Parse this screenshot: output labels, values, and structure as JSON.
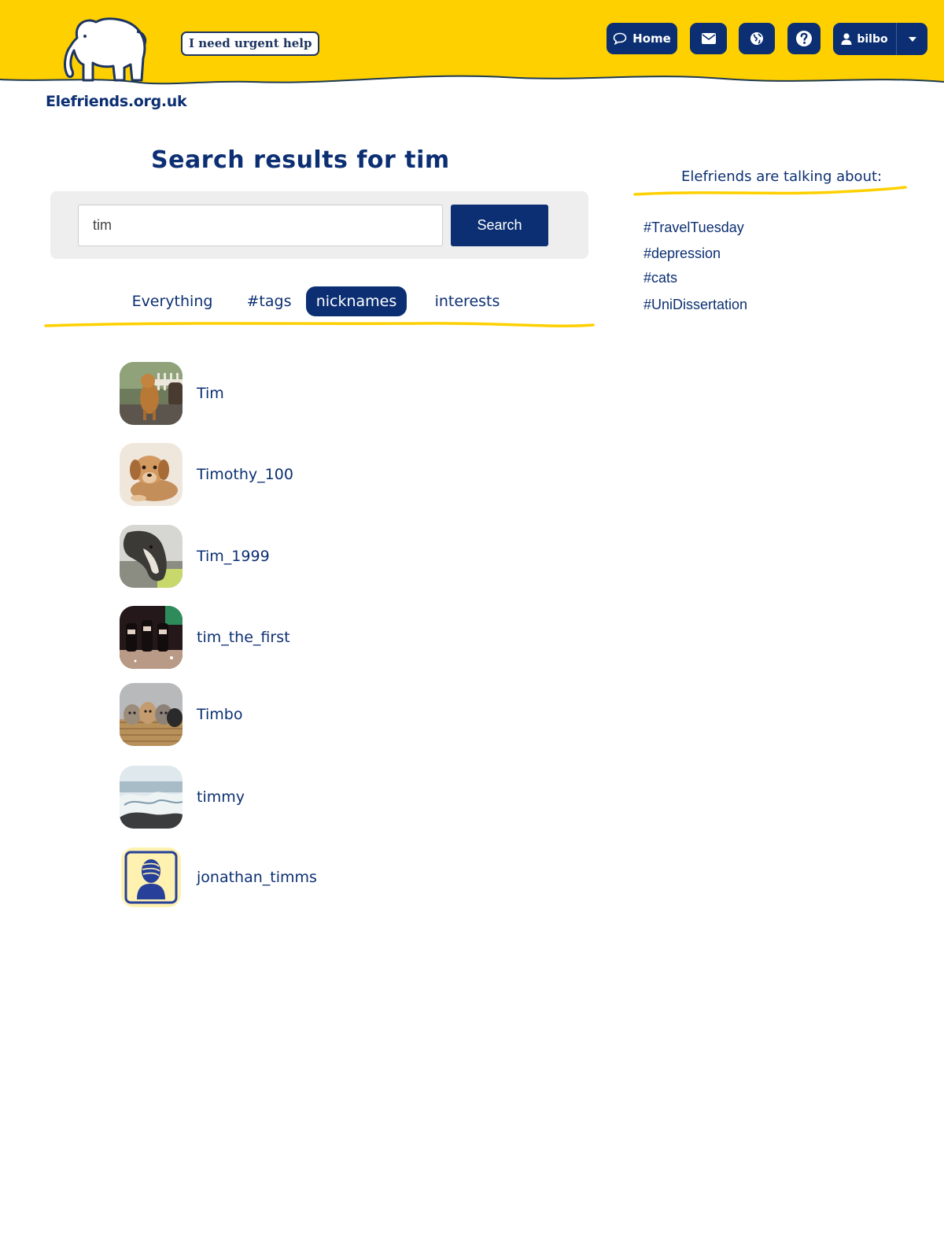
{
  "header": {
    "site_name": "Elefriends.org.uk",
    "urgent_label": "I need urgent help",
    "nav": {
      "home_label": "Home",
      "mail_icon": "envelope-icon",
      "globe_icon": "globe-icon",
      "help_icon": "question-icon",
      "user_label": "bilbo"
    }
  },
  "main": {
    "title": "Search results for tim",
    "search": {
      "value": "tim",
      "button_label": "Search"
    },
    "tabs": [
      {
        "label": "Everything",
        "active": false
      },
      {
        "label": "#tags",
        "active": false
      },
      {
        "label": "nicknames",
        "active": true
      },
      {
        "label": "interests",
        "active": false
      }
    ],
    "results": [
      {
        "name": "Tim",
        "avatar": "dog-sitting-photo"
      },
      {
        "name": "Timothy_100",
        "avatar": "puppy-photo"
      },
      {
        "name": "Tim_1999",
        "avatar": "greyhound-photo"
      },
      {
        "name": "tim_the_first",
        "avatar": "bottles-photo"
      },
      {
        "name": "Timbo",
        "avatar": "kittens-photo"
      },
      {
        "name": "timmy",
        "avatar": "sea-waves-photo"
      },
      {
        "name": "jonathan_timms",
        "avatar": "default-person-avatar"
      }
    ]
  },
  "sidebar": {
    "title": "Elefriends are talking about:",
    "trends": [
      "#TravelTuesday",
      "#depression",
      "#cats",
      "#UniDissertation"
    ]
  },
  "colors": {
    "brand_yellow": "#ffd000",
    "brand_navy": "#0b2f72",
    "panel_grey": "#eeeeee"
  }
}
